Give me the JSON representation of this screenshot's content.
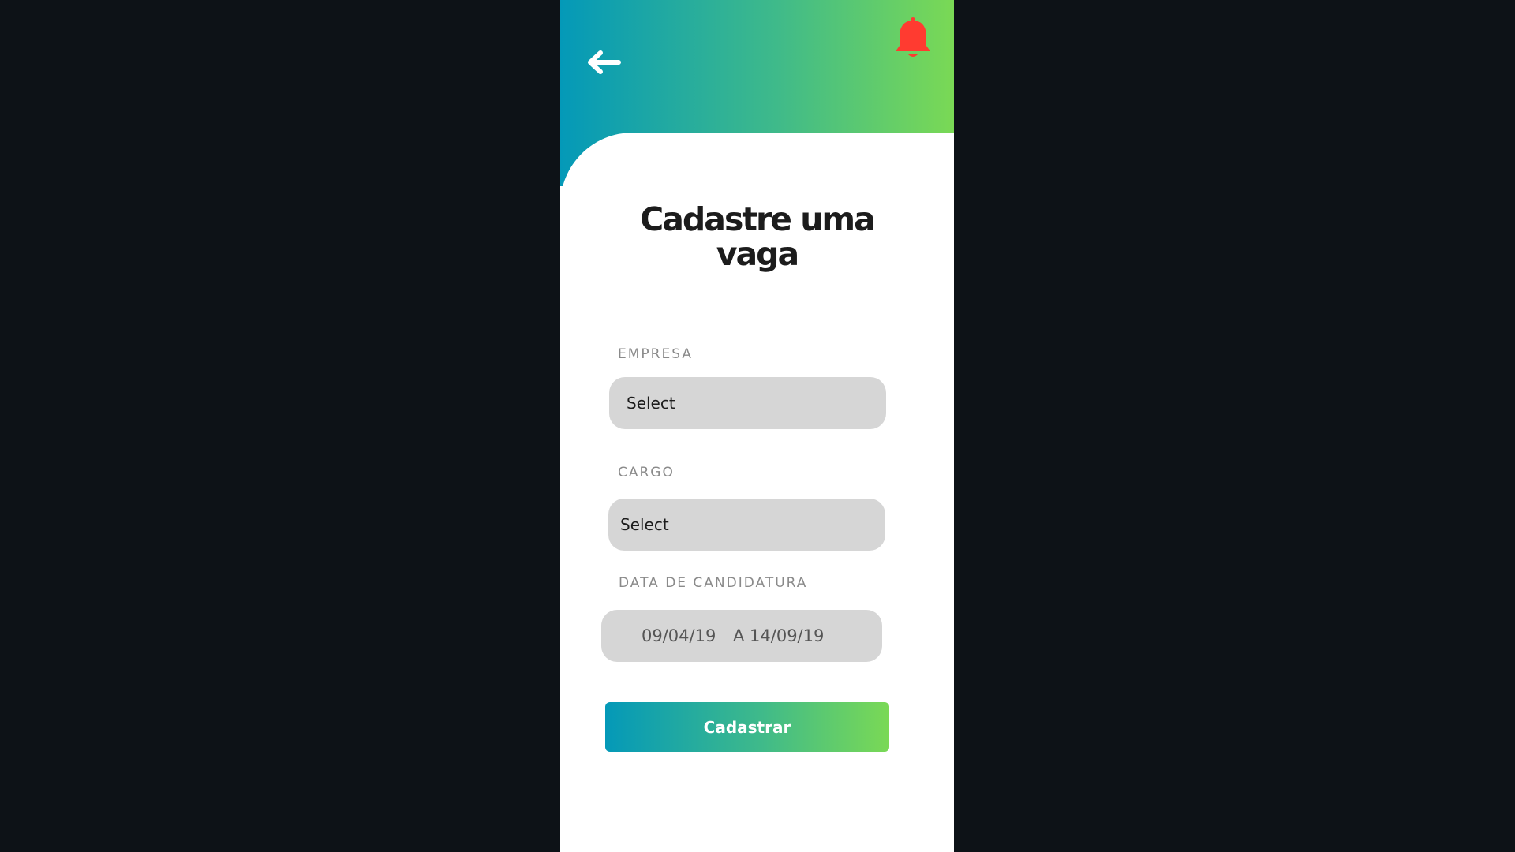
{
  "header": {
    "back_icon": "arrow-left-icon",
    "notification_icon": "bell-icon",
    "notification_color": "#ff3b30",
    "gradient_start": "#0499b8",
    "gradient_end": "#7ad955"
  },
  "title": {
    "line1": "Cadastre uma",
    "line2": "vaga"
  },
  "form": {
    "empresa": {
      "label": "EMPRESA",
      "value": "Select"
    },
    "cargo": {
      "label": "CARGO",
      "value": "Select"
    },
    "data_candidatura": {
      "label": "DATA DE CANDIDATURA",
      "start": "09/04/19",
      "end": "A 14/09/19"
    },
    "submit_label": "Cadastrar"
  }
}
